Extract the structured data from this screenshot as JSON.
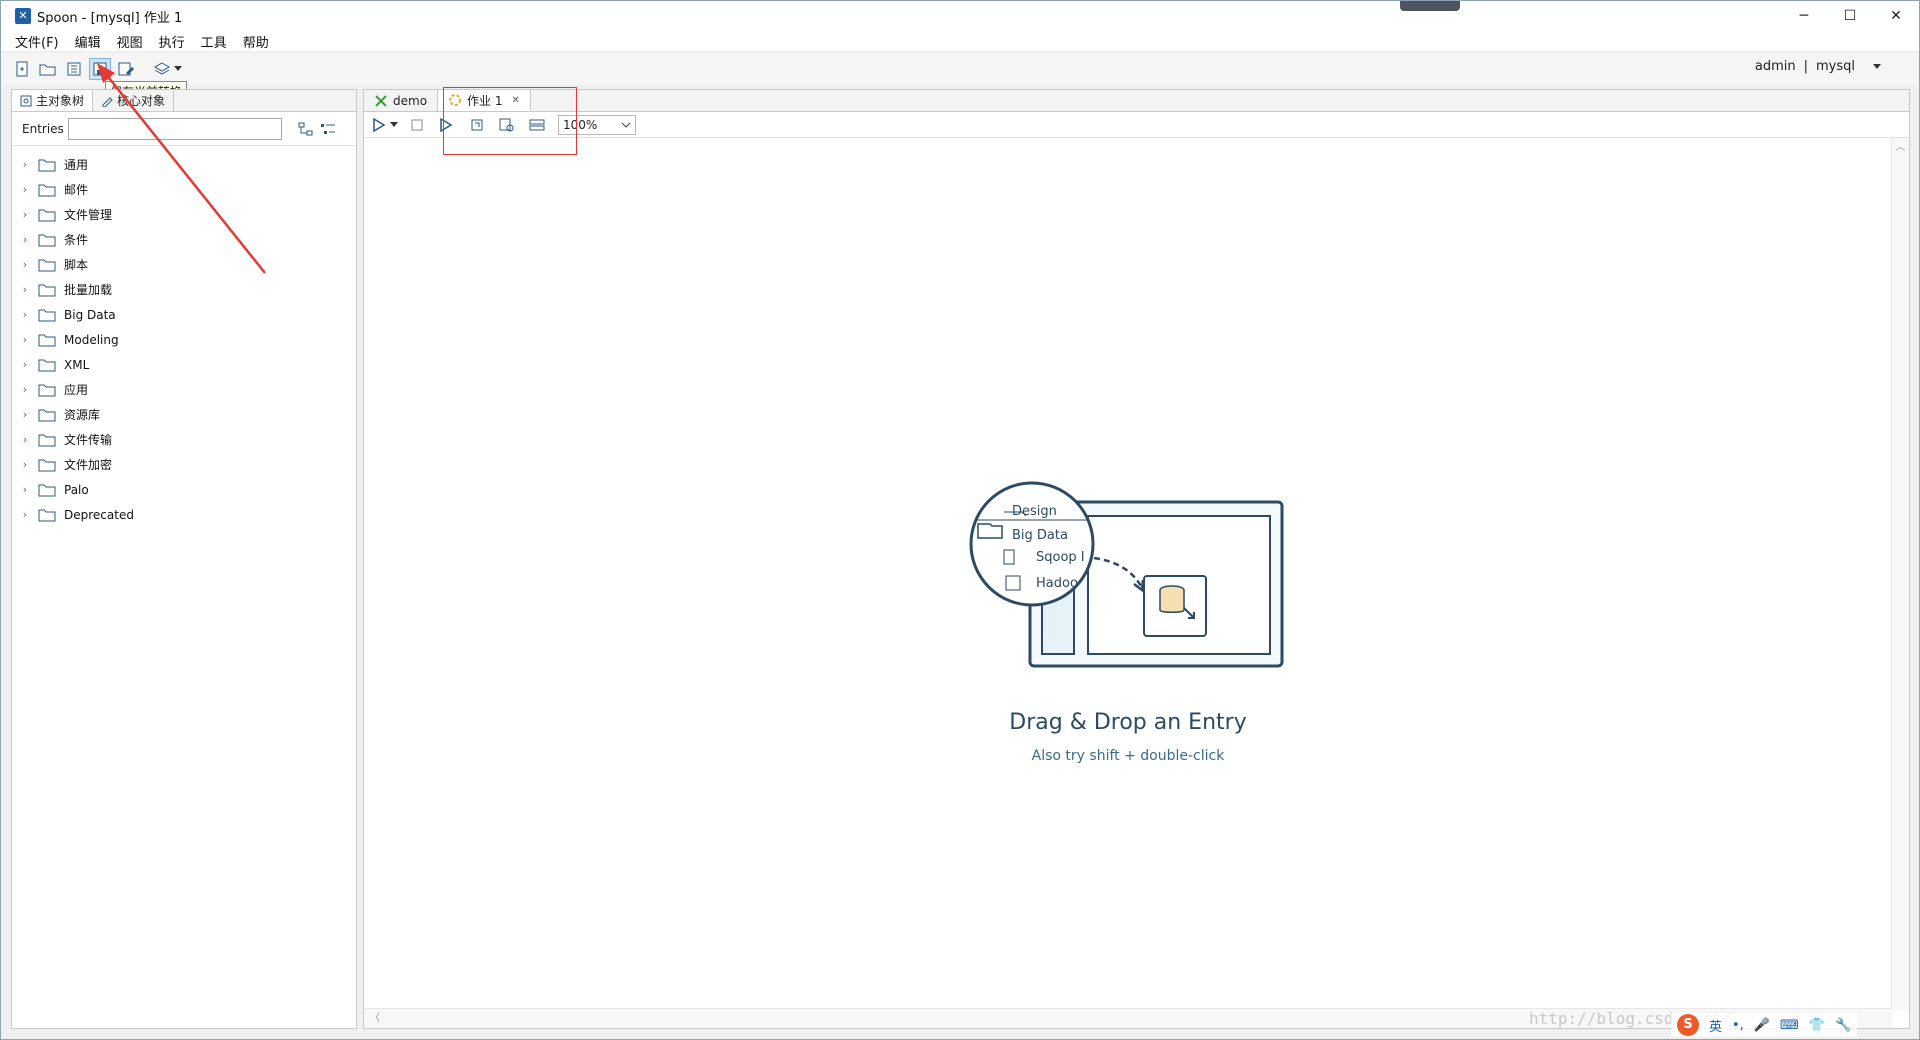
{
  "window": {
    "title": "Spoon - [mysql] 作业 1",
    "app_icon": "spoon-icon",
    "controls": [
      "minimize",
      "maximize",
      "close"
    ]
  },
  "menu": [
    "文件(F)",
    "编辑",
    "视图",
    "执行",
    "工具",
    "帮助"
  ],
  "toolbar": {
    "tooltip": "保存当前转换",
    "user": "admin",
    "separator": "|",
    "repository": "mysql"
  },
  "left_panel": {
    "tabs": [
      "主对象树",
      "核心对象"
    ],
    "entries_label": "Entries",
    "entries_value": "",
    "tree": [
      "通用",
      "邮件",
      "文件管理",
      "条件",
      "脚本",
      "批量加载",
      "Big Data",
      "Modeling",
      "XML",
      "应用",
      "资源库",
      "文件传输",
      "文件加密",
      "Palo",
      "Deprecated"
    ]
  },
  "editor": {
    "tabs": [
      {
        "label": "demo",
        "icon": "transformation-icon"
      },
      {
        "label": "作业 1",
        "icon": "job-icon",
        "active": true
      }
    ],
    "zoom": "100%"
  },
  "canvas": {
    "illustration": {
      "tab": "Design",
      "folder": "Big Data",
      "item1": "Sqoop In",
      "item2": "Hadoo"
    },
    "title": "Drag & Drop an Entry",
    "subtitle": "Also try shift + double-click"
  },
  "watermark": "http://blog.csdn.net/",
  "ime": {
    "lang": "英",
    "logo": "S"
  },
  "colors": {
    "accent": "#2c4a63",
    "highlight": "#e53935"
  }
}
